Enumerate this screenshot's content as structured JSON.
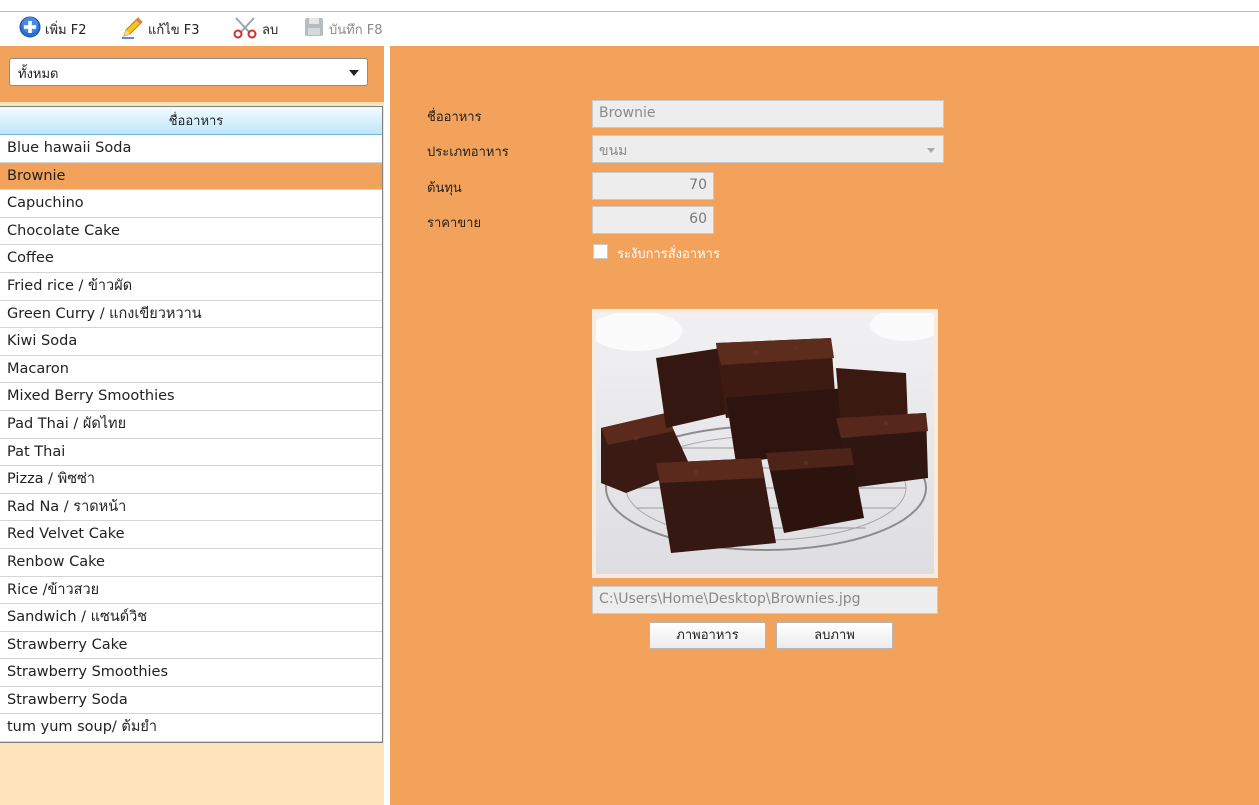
{
  "toolbar": {
    "add_label": "เพิ่ม F2",
    "edit_label": "แก้ไข F3",
    "delete_label": "ลบ",
    "save_label": "บันทึก F8",
    "icons": [
      "add-circle-icon",
      "pencil-icon",
      "scissors-icon",
      "floppy-disk-icon"
    ]
  },
  "filter": {
    "selected": "ทั้งหมด"
  },
  "list": {
    "header": "ชื่ออาหาร",
    "selected_index": 1,
    "items": [
      "Blue hawaii Soda",
      "Brownie",
      "Capuchino",
      "Chocolate Cake",
      "Coffee",
      "Fried rice / ข้าวผัด",
      "Green Curry / แกงเขียวหวาน",
      "Kiwi Soda",
      "Macaron",
      "Mixed Berry Smoothies",
      "Pad Thai / ผัดไทย",
      "Pat Thai",
      "Pizza / พิซซ่า",
      "Rad Na / ราดหน้า",
      "Red Velvet Cake",
      "Renbow Cake",
      "Rice /ข้าวสวย",
      "Sandwich / แซนด์วิช",
      "Strawberry Cake",
      "Strawberry Smoothies",
      "Strawberry Soda",
      "tum yum soup/ ต้มยำ"
    ]
  },
  "form": {
    "name_label": "ชื่ออาหาร",
    "name_value": "Brownie",
    "type_label": "ประเภทอาหาร",
    "type_value": "ขนม",
    "cost_label": "ต้นทุน",
    "cost_value": "70",
    "price_label": "ราคาขาย",
    "price_value": "60",
    "suspend_label": "ระงับการสั่งอาหาร",
    "suspend_checked": false,
    "image_path": "C:\\Users\\Home\\Desktop\\Brownies.jpg",
    "image_button": "ภาพอาหาร",
    "delete_image_button": "ลบภาพ"
  },
  "colors": {
    "panel_orange": "#f3a25c",
    "list_bg": "#fde4bd",
    "header_blue": "#bfe6fb"
  }
}
